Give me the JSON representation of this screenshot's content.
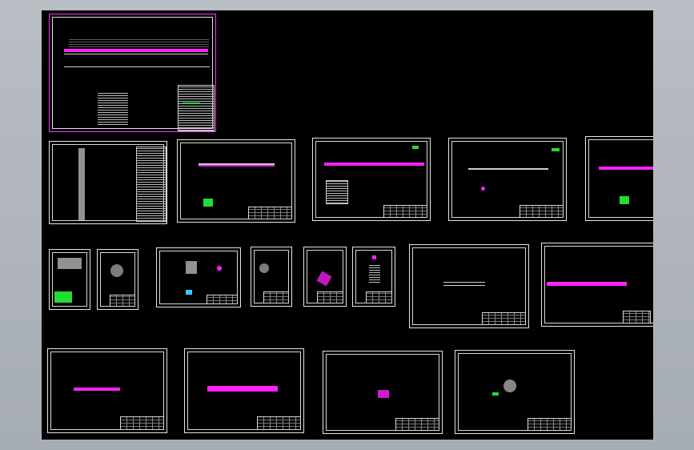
{
  "viewer": {
    "background_color": "#000000",
    "frame_color": "#b0b5bb",
    "selected_color": "#ff33ff",
    "annotation_color": "#22dd33",
    "part_color": "#ff22ff"
  },
  "sheets": [
    {
      "id": "assembly-drawing",
      "selected": true
    },
    {
      "id": "parts-list"
    },
    {
      "id": "part-2"
    },
    {
      "id": "part-3"
    },
    {
      "id": "part-4"
    },
    {
      "id": "part-5"
    },
    {
      "id": "part-6"
    },
    {
      "id": "part-7"
    },
    {
      "id": "part-8"
    },
    {
      "id": "part-9"
    },
    {
      "id": "part-10"
    },
    {
      "id": "part-11"
    },
    {
      "id": "part-12"
    },
    {
      "id": "part-13"
    },
    {
      "id": "part-14"
    },
    {
      "id": "part-15"
    },
    {
      "id": "part-16"
    },
    {
      "id": "part-17"
    }
  ]
}
